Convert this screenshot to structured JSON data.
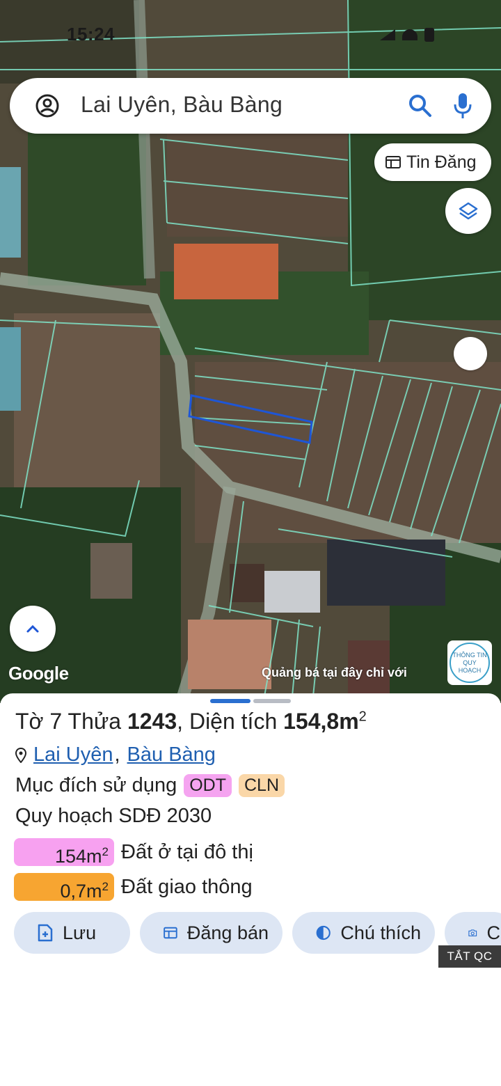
{
  "status_bar": {
    "time": "15:24"
  },
  "search": {
    "query": "Lai Uyên, Bàu Bàng"
  },
  "map_controls": {
    "tin_dang_label": "Tin Đăng"
  },
  "map": {
    "google_logo": "Google",
    "ad_text": "Quảng bá tại đây chỉ với",
    "badge_line1": "THÔNG TIN",
    "badge_line2": "QUY HOẠCH",
    "parcel_line_color": "#7fe3c8",
    "selected_parcel_color": "#1e56d6"
  },
  "sheet": {
    "title_prefix": "Tờ 7 Thửa ",
    "parcel_no": "1243",
    "title_mid": ", Diện tích ",
    "area": "154,8m",
    "area_sup": "2",
    "location_commune": "Lai Uyên",
    "location_district": "Bàu Bàng",
    "location_sep": ",",
    "purpose_label": "Mục đích sử dụng",
    "purpose_tags": [
      "ODT",
      "CLN"
    ],
    "plan_label": "Quy hoạch SDĐ 2030",
    "breakdown": [
      {
        "value": "154m",
        "sup": "2",
        "label": "Đất ở tại đô thị",
        "color": "#f7a1f0"
      },
      {
        "value": "0,7m",
        "sup": "2",
        "label": "Đất giao thông",
        "color": "#f7a531"
      }
    ],
    "actions": [
      "Lưu",
      "Đăng bán",
      "Chú thích",
      "C"
    ],
    "ad_close": "TẮT QC"
  }
}
